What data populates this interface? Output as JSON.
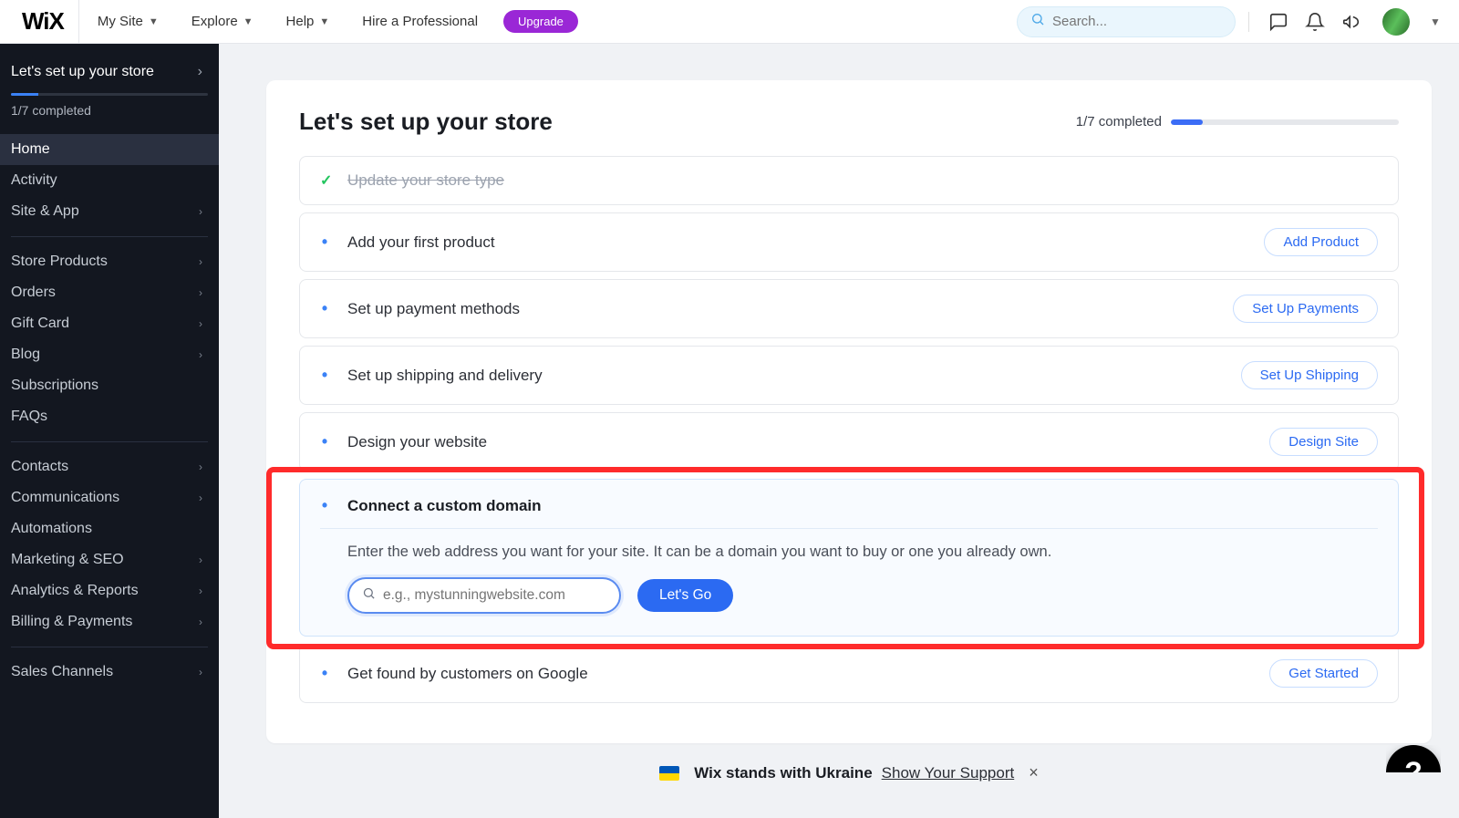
{
  "header": {
    "logo": "WiX",
    "site_selector": "My Site",
    "nav": [
      "Explore",
      "Help",
      "Hire a Professional"
    ],
    "upgrade": "Upgrade",
    "search_placeholder": "Search..."
  },
  "sidebar": {
    "setup_title": "Let's set up your store",
    "progress_text": "1/7 completed",
    "groups": [
      {
        "items": [
          {
            "label": "Home",
            "active": true,
            "chev": false
          },
          {
            "label": "Activity",
            "chev": false
          },
          {
            "label": "Site & App",
            "chev": true
          }
        ]
      },
      {
        "items": [
          {
            "label": "Store Products",
            "chev": true
          },
          {
            "label": "Orders",
            "chev": true
          },
          {
            "label": "Gift Card",
            "chev": true
          },
          {
            "label": "Blog",
            "chev": true
          },
          {
            "label": "Subscriptions",
            "chev": false
          },
          {
            "label": "FAQs",
            "chev": false
          }
        ]
      },
      {
        "items": [
          {
            "label": "Contacts",
            "chev": true
          },
          {
            "label": "Communications",
            "chev": true
          },
          {
            "label": "Automations",
            "chev": false
          },
          {
            "label": "Marketing & SEO",
            "chev": true
          },
          {
            "label": "Analytics & Reports",
            "chev": true
          },
          {
            "label": "Billing & Payments",
            "chev": true
          }
        ]
      },
      {
        "items": [
          {
            "label": "Sales Channels",
            "chev": true
          }
        ]
      }
    ]
  },
  "main": {
    "title": "Let's set up your store",
    "progress_text": "1/7 completed",
    "steps": [
      {
        "label": "Update your store type",
        "done": true
      },
      {
        "label": "Add your first product",
        "action": "Add Product"
      },
      {
        "label": "Set up payment methods",
        "action": "Set Up Payments"
      },
      {
        "label": "Set up shipping and delivery",
        "action": "Set Up Shipping"
      },
      {
        "label": "Design your website",
        "action": "Design Site"
      },
      {
        "label": "Connect a custom domain",
        "expanded": true,
        "desc": "Enter the web address you want for your site. It can be a domain you want to buy or one you already own.",
        "placeholder": "e.g., mystunningwebsite.com",
        "go": "Let's Go"
      },
      {
        "label": "Get found by customers on Google",
        "action": "Get Started"
      }
    ]
  },
  "ukraine": {
    "text": "Wix stands with Ukraine",
    "link": "Show Your Support"
  }
}
